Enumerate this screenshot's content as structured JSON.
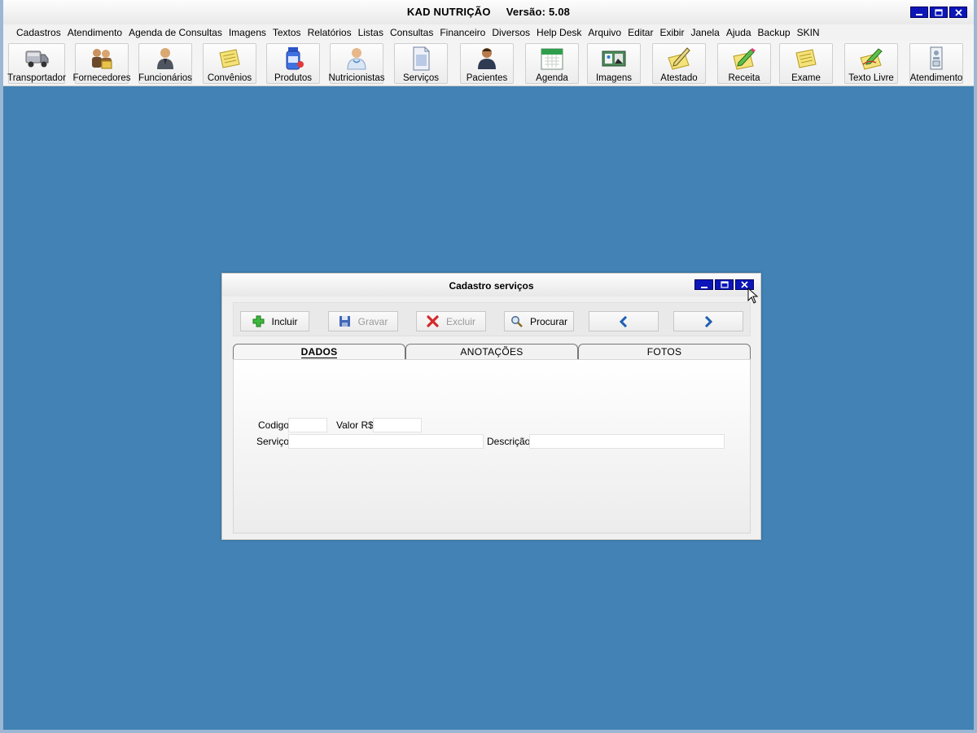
{
  "app": {
    "title": "KAD NUTRIÇÃO     Versão: 5.08"
  },
  "menu": [
    "Cadastros",
    "Atendimento",
    "Agenda de Consultas",
    "Imagens",
    "Textos",
    "Relatórios",
    "Listas",
    "Consultas",
    "Financeiro",
    "Diversos",
    "Help Desk",
    "Arquivo",
    "Editar",
    "Exibir",
    "Janela",
    "Ajuda",
    "Backup",
    "SKIN"
  ],
  "toolbar": [
    {
      "label": "Transportador",
      "icon": "truck-icon"
    },
    {
      "label": "Fornecedores",
      "icon": "suppliers-icon"
    },
    {
      "label": "Funcionários",
      "icon": "employee-icon"
    },
    {
      "label": "Convênios",
      "icon": "notepad-icon"
    },
    {
      "label": "Produtos",
      "icon": "medicine-bottle-icon"
    },
    {
      "label": "Nutricionistas",
      "icon": "nutritionist-icon"
    },
    {
      "label": "Serviços",
      "icon": "document-icon"
    },
    {
      "label": "Pacientes",
      "icon": "patient-icon"
    },
    {
      "label": "Agenda",
      "icon": "calendar-icon"
    },
    {
      "label": "Imagens",
      "icon": "images-icon"
    },
    {
      "label": "Atestado",
      "icon": "certificate-pen-icon"
    },
    {
      "label": "Receita",
      "icon": "prescription-pen-icon"
    },
    {
      "label": "Exame",
      "icon": "exam-notepad-icon"
    },
    {
      "label": "Texto Livre",
      "icon": "free-text-icon"
    },
    {
      "label": "Atendimento",
      "icon": "attendance-icon"
    }
  ],
  "dialog": {
    "title": "Cadastro serviços",
    "buttons": {
      "incluir": "Incluir",
      "gravar": "Gravar",
      "excluir": "Excluir",
      "procurar": "Procurar"
    },
    "tabs": [
      "DADOS",
      "ANOTAÇÕES",
      "FOTOS"
    ],
    "active_tab": "DADOS",
    "fields": {
      "codigo_label": "Codigo",
      "codigo_value": "",
      "valor_label": "Valor R$",
      "valor_value": "",
      "servico_label": "Serviço",
      "servico_value": "",
      "descricao_label": "Descrição",
      "descricao_value": ""
    }
  },
  "colors": {
    "desktop": "#4282b4",
    "window_button": "#0c16b8"
  }
}
